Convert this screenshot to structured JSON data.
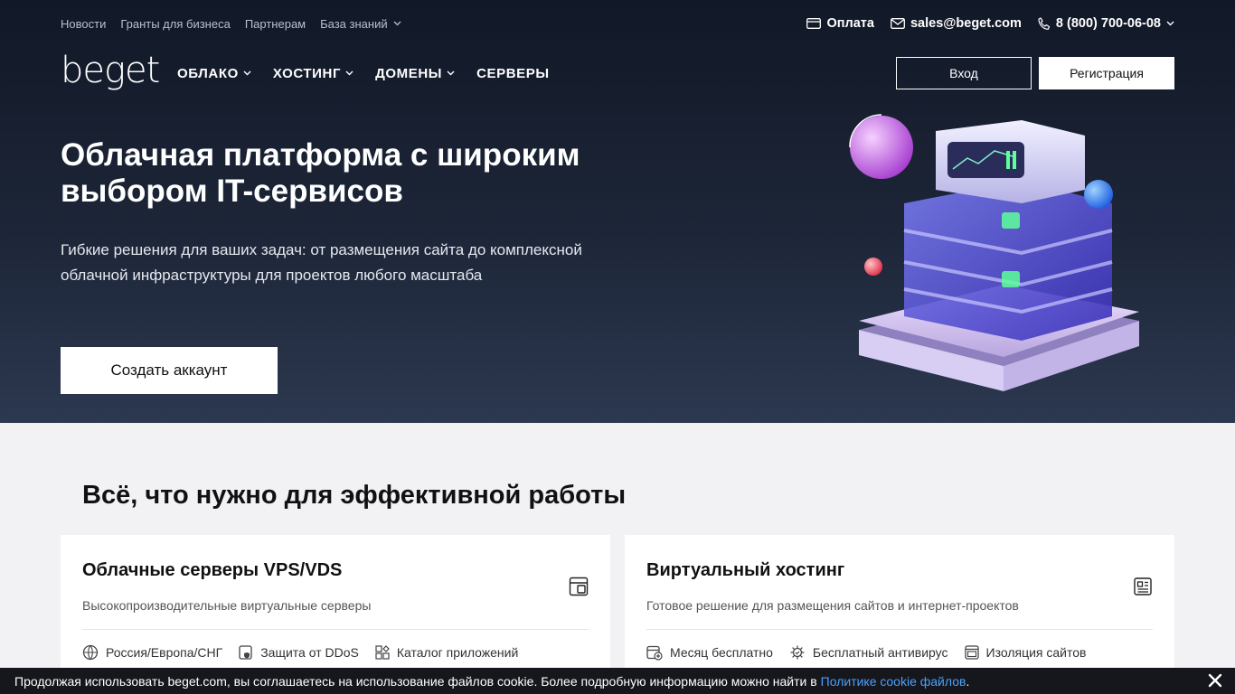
{
  "top_links": [
    {
      "label": "Новости"
    },
    {
      "label": "Гранты для бизнеса"
    },
    {
      "label": "Партнерам"
    },
    {
      "label": "База знаний",
      "has_dropdown": true
    }
  ],
  "contacts": {
    "payment": "Оплата",
    "email": "sales@beget.com",
    "phone": "8 (800) 700-06-08"
  },
  "logo": "beget",
  "main_nav": [
    {
      "label": "ОБЛАКО",
      "has_dropdown": true
    },
    {
      "label": "ХОСТИНГ",
      "has_dropdown": true
    },
    {
      "label": "ДОМЕНЫ",
      "has_dropdown": true
    },
    {
      "label": "СЕРВЕРЫ",
      "has_dropdown": false
    }
  ],
  "auth": {
    "login": "Вход",
    "register": "Регистрация"
  },
  "hero": {
    "title": "Облачная платформа с широким выбором IT-сервисов",
    "subtitle": "Гибкие решения для ваших задач: от размещения сайта до комплексной облачной инфраструктуры для проектов любого масштаба",
    "cta": "Создать аккаунт"
  },
  "section_title": "Всё, что нужно для эффективной работы",
  "cards": [
    {
      "title": "Облачные серверы VPS/VDS",
      "desc": "Высокопроизводительные виртуальные серверы",
      "icon": "cloud-server-icon",
      "features": [
        {
          "label": "Россия/Европа/СНГ",
          "icon": "globe-icon"
        },
        {
          "label": "Защита от DDoS",
          "icon": "shield-icon"
        },
        {
          "label": "Каталог приложений",
          "icon": "apps-icon"
        }
      ]
    },
    {
      "title": "Виртуальный хостинг",
      "desc": "Готовое решение для размещения сайтов и интернет-проектов",
      "icon": "hosting-icon",
      "features": [
        {
          "label": "Месяц бесплатно",
          "icon": "calendar-icon"
        },
        {
          "label": "Бесплатный антивирус",
          "icon": "antivirus-icon"
        },
        {
          "label": "Изоляция сайтов",
          "icon": "isolation-icon"
        }
      ]
    }
  ],
  "cookie": {
    "text": "Продолжая использовать beget.com, вы соглашаетесь на использование файлов cookie. Более подробную информацию можно найти в",
    "link": "Политике cookie файлов",
    "tail": "."
  },
  "colors": {
    "hero_top": "#111827",
    "hero_bottom": "#2c3850",
    "link": "#4aa0ff",
    "page_bg": "#f2f2f4"
  }
}
